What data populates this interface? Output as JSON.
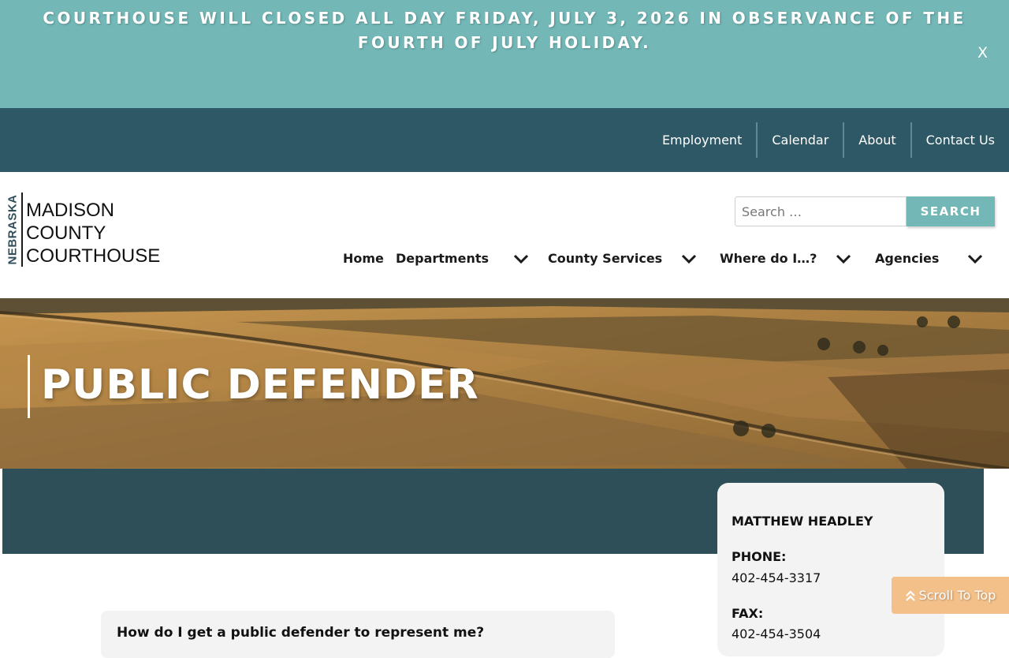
{
  "alert": {
    "text": "COURTHOUSE WILL CLOSED ALL DAY FRIDAY, JULY 3, 2026 IN OBSERVANCE OF THE FOURTH OF JULY HOLIDAY.",
    "close_label": "X"
  },
  "utility_nav": {
    "items": [
      {
        "label": "Employment"
      },
      {
        "label": "Calendar"
      },
      {
        "label": "About"
      },
      {
        "label": "Contact Us"
      }
    ]
  },
  "logo": {
    "vertical_text": "NEBRASKA",
    "lines": [
      "MADISON",
      "COUNTY",
      "COURTHOUSE"
    ]
  },
  "search": {
    "placeholder": "Search …",
    "button_label": "SEARCH"
  },
  "main_nav": {
    "items": [
      {
        "label": "Home",
        "has_dropdown": false
      },
      {
        "label": "Departments",
        "has_dropdown": true
      },
      {
        "label": "County Services",
        "has_dropdown": true
      },
      {
        "label": "Where do I…?",
        "has_dropdown": true
      },
      {
        "label": "Agencies",
        "has_dropdown": true
      }
    ]
  },
  "hero": {
    "title": "PUBLIC DEFENDER"
  },
  "contact_card": {
    "name": "MATTHEW HEADLEY",
    "phone_label": "PHONE:",
    "phone": "402-454-3317",
    "fax_label": "FAX:",
    "fax": "402-454-3504"
  },
  "accordion": {
    "question": "How do I get a public defender to represent me?"
  },
  "scroll_top": {
    "label": "Scroll To Top"
  },
  "colors": {
    "alert_bg": "#73b7b7",
    "utility_bg": "#2e5865",
    "band_bg": "#2e4f58",
    "search_button": "#73b7b7",
    "scroll_top_bg": "#f3c08a"
  }
}
